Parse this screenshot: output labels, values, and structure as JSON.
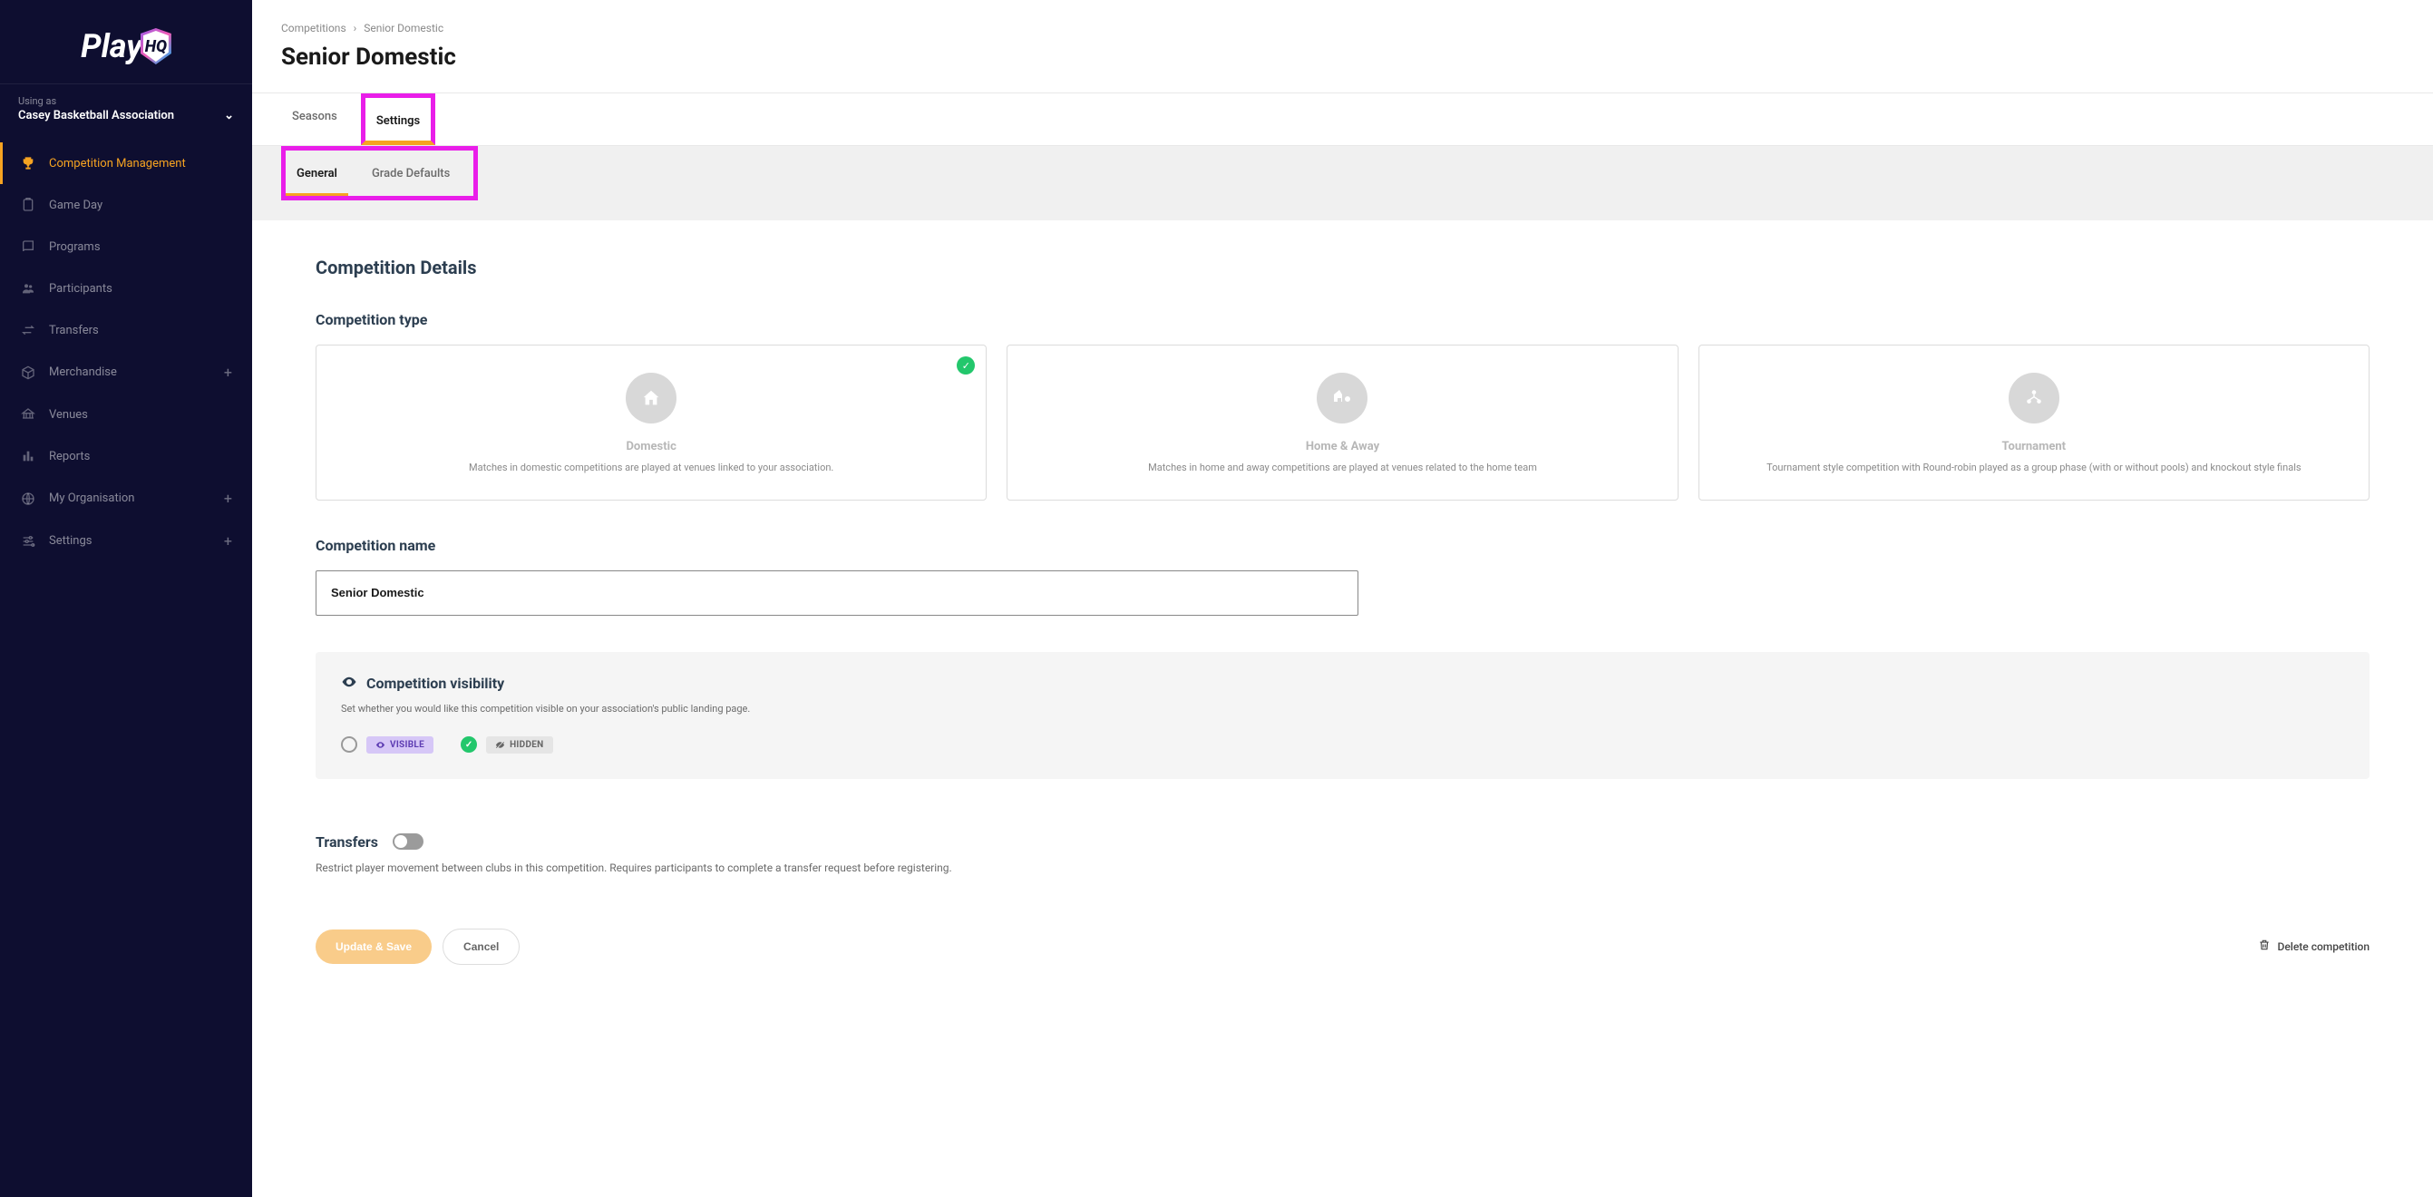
{
  "brand": {
    "name": "PlayHQ"
  },
  "sidebar": {
    "using_as_label": "Using as",
    "org_name": "Casey Basketball Association",
    "items": [
      {
        "label": "Competition Management",
        "icon": "trophy-icon",
        "active": true,
        "expandable": false
      },
      {
        "label": "Game Day",
        "icon": "clipboard-icon",
        "active": false,
        "expandable": false
      },
      {
        "label": "Programs",
        "icon": "book-icon",
        "active": false,
        "expandable": false
      },
      {
        "label": "Participants",
        "icon": "users-icon",
        "active": false,
        "expandable": false
      },
      {
        "label": "Transfers",
        "icon": "transfer-icon",
        "active": false,
        "expandable": false
      },
      {
        "label": "Merchandise",
        "icon": "box-icon",
        "active": false,
        "expandable": true
      },
      {
        "label": "Venues",
        "icon": "court-icon",
        "active": false,
        "expandable": false
      },
      {
        "label": "Reports",
        "icon": "chart-icon",
        "active": false,
        "expandable": false
      },
      {
        "label": "My Organisation",
        "icon": "globe-icon",
        "active": false,
        "expandable": true
      },
      {
        "label": "Settings",
        "icon": "sliders-icon",
        "active": false,
        "expandable": true
      }
    ]
  },
  "header": {
    "breadcrumb": {
      "parent": "Competitions",
      "current": "Senior Domestic"
    },
    "title": "Senior Domestic"
  },
  "tabs": [
    {
      "label": "Seasons",
      "active": false
    },
    {
      "label": "Settings",
      "active": true
    }
  ],
  "subtabs": [
    {
      "label": "General",
      "active": true
    },
    {
      "label": "Grade Defaults",
      "active": false
    }
  ],
  "details": {
    "section_title": "Competition Details",
    "type_label": "Competition type",
    "types": [
      {
        "title": "Domestic",
        "desc": "Matches in domestic competitions are played at venues linked to your association.",
        "selected": true,
        "icon": "home-icon"
      },
      {
        "title": "Home & Away",
        "desc": "Matches in home and away competitions are played at venues related to the home team",
        "selected": false,
        "icon": "home-away-icon"
      },
      {
        "title": "Tournament",
        "desc": "Tournament style competition with Round-robin played as a group phase (with or without pools) and knockout style finals",
        "selected": false,
        "icon": "bracket-icon"
      }
    ],
    "name_label": "Competition name",
    "name_value": "Senior Domestic",
    "visibility": {
      "title": "Competition visibility",
      "desc": "Set whether you would like this competition visible on your association's public landing page.",
      "options": [
        {
          "label": "VISIBLE",
          "checked": false,
          "variant": "visible"
        },
        {
          "label": "HIDDEN",
          "checked": true,
          "variant": "hidden"
        }
      ]
    },
    "transfers": {
      "title": "Transfers",
      "enabled": false,
      "desc": "Restrict player movement between clubs in this competition. Requires participants to complete a transfer request before registering."
    },
    "actions": {
      "save": "Update & Save",
      "cancel": "Cancel",
      "delete": "Delete competition"
    }
  }
}
